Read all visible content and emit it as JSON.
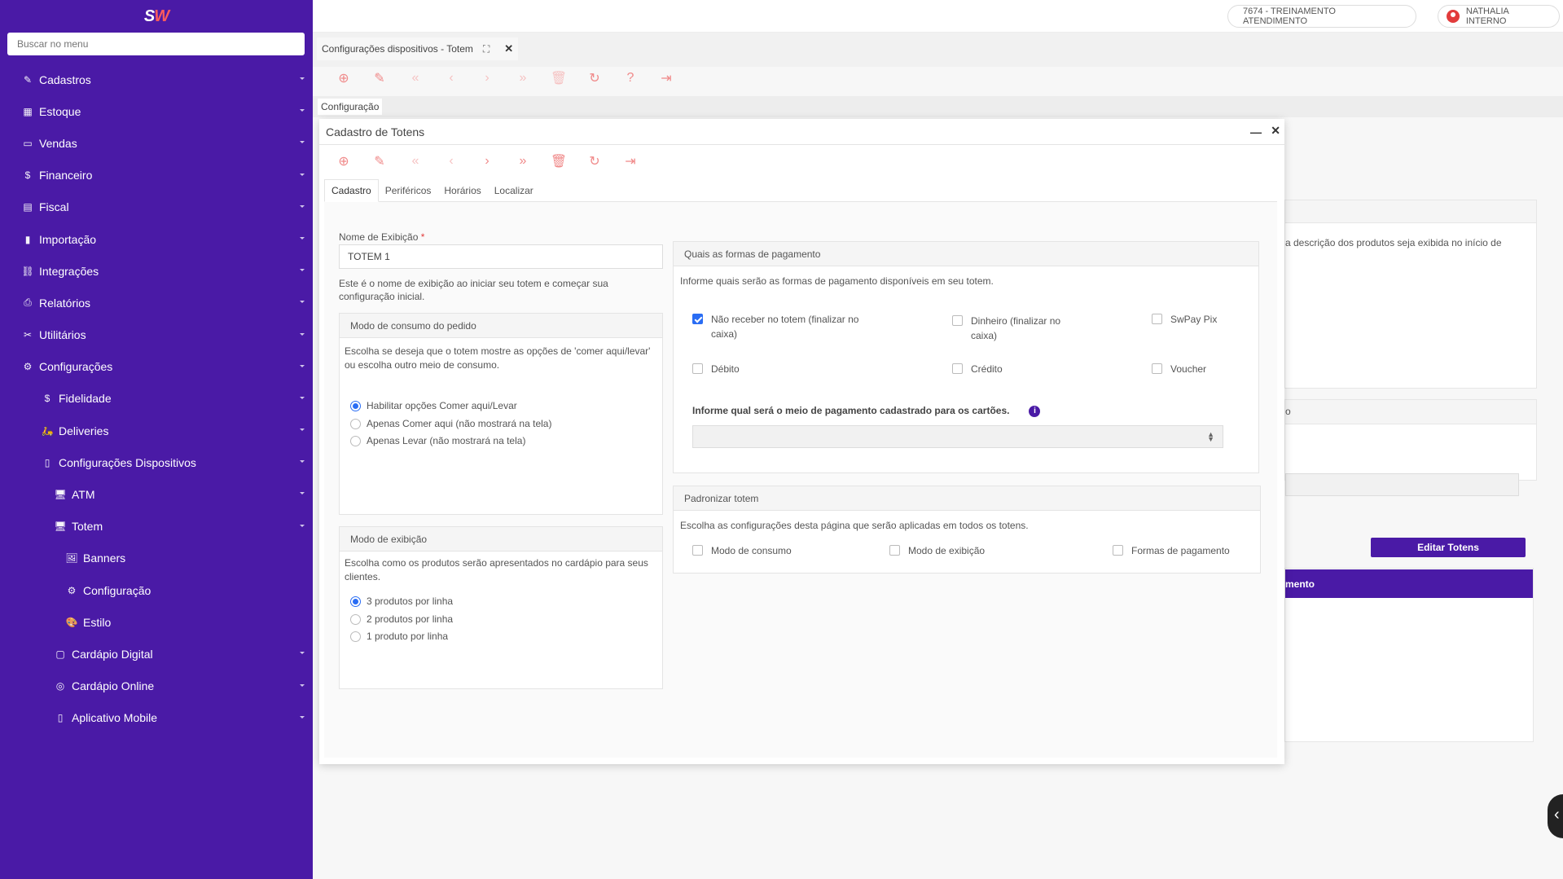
{
  "app": {
    "logo_a": "S",
    "logo_b": "W"
  },
  "sidebar": {
    "search_placeholder": "Buscar no menu",
    "items": [
      {
        "label": "Cadastros",
        "icon": "✎"
      },
      {
        "label": "Estoque",
        "icon": "▦"
      },
      {
        "label": "Vendas",
        "icon": "▭"
      },
      {
        "label": "Financeiro",
        "icon": "$"
      },
      {
        "label": "Fiscal",
        "icon": "▤"
      },
      {
        "label": "Importação",
        "icon": "▮"
      },
      {
        "label": "Integrações",
        "icon": "⛓"
      },
      {
        "label": "Relatórios",
        "icon": "⎙"
      },
      {
        "label": "Utilitários",
        "icon": "✂"
      },
      {
        "label": "Configurações",
        "icon": "⚙"
      },
      {
        "label": "Fidelidade",
        "icon": "$"
      },
      {
        "label": "Deliveries",
        "icon": "🛵"
      },
      {
        "label": "Configurações Dispositivos",
        "icon": "▯"
      },
      {
        "label": "ATM",
        "icon": "🖥"
      },
      {
        "label": "Totem",
        "icon": "🖥"
      },
      {
        "label": "Banners",
        "icon": "🖼"
      },
      {
        "label": "Configuração",
        "icon": "⚙"
      },
      {
        "label": "Estilo",
        "icon": "🎨"
      },
      {
        "label": "Cardápio Digital",
        "icon": "▢"
      },
      {
        "label": "Cardápio Online",
        "icon": "◎"
      },
      {
        "label": "Aplicativo Mobile",
        "icon": "▯"
      }
    ]
  },
  "topbar": {
    "environment": "7674 - TREINAMENTO ATENDIMENTO",
    "user": "NATHALIA INTERNO"
  },
  "page_tab": {
    "label": "Configurações dispositivos - Totem",
    "expand_icon": "⛶",
    "close_icon": "✕"
  },
  "toolbar_icons": {
    "add": "⊕",
    "edit": "✎",
    "first": "«",
    "prev": "‹",
    "next": "›",
    "last": "»",
    "delete": "🗑",
    "refresh": "↻",
    "help": "?",
    "exit": "⇥"
  },
  "subtab": {
    "label": "Configuração"
  },
  "background": {
    "desc_text": "a descrição dos produtos seja exibida no início de",
    "letter_o": "o",
    "edit_button": "Editar Totens",
    "purple_bar_text": "mento"
  },
  "modal": {
    "title": "Cadastro de Totens",
    "min_icon": "—",
    "close_icon": "✕",
    "tabs": [
      "Cadastro",
      "Periféricos",
      "Horários",
      "Localizar"
    ],
    "name_label": "Nome de Exibição",
    "name_required": "*",
    "name_value": "TOTEM 1",
    "name_help": "Este é o nome de exibição ao iniciar seu totem e começar sua configuração inicial.",
    "consumo": {
      "title": "Modo de consumo do pedido",
      "desc": "Escolha se deseja que o totem mostre as opções de 'comer aqui/levar' ou escolha outro meio de consumo.",
      "options": [
        "Habilitar opções Comer aqui/Levar",
        "Apenas Comer aqui (não mostrará na tela)",
        "Apenas Levar (não mostrará na tela)"
      ],
      "selected": 0
    },
    "exibicao": {
      "title": "Modo de exibição",
      "desc": "Escolha como os produtos serão apresentados no cardápio para seus clientes.",
      "options": [
        "3 produtos por linha",
        "2 produtos por linha",
        "1 produto por linha"
      ],
      "selected": 0
    },
    "pagamento": {
      "title": "Quais as formas de pagamento",
      "desc": "Informe quais serão as formas de pagamento disponíveis em seu totem.",
      "options": [
        {
          "label": "Não receber no totem (finalizar no caixa)",
          "checked": true
        },
        {
          "label": "Dinheiro (finalizar no caixa)",
          "checked": false
        },
        {
          "label": "SwPay Pix",
          "checked": false
        },
        {
          "label": "Débito",
          "checked": false
        },
        {
          "label": "Crédito",
          "checked": false
        },
        {
          "label": "Voucher",
          "checked": false
        }
      ],
      "cards_label": "Informe qual será o meio de pagamento cadastrado para os cartões.",
      "info_icon": "i",
      "select_value": ""
    },
    "padronizar": {
      "title": "Padronizar totem",
      "desc": "Escolha as configurações desta página que serão aplicadas em todos os totens.",
      "options": [
        {
          "label": "Modo de consumo",
          "checked": false
        },
        {
          "label": "Modo de exibição",
          "checked": false
        },
        {
          "label": "Formas de pagamento",
          "checked": false
        }
      ]
    }
  }
}
